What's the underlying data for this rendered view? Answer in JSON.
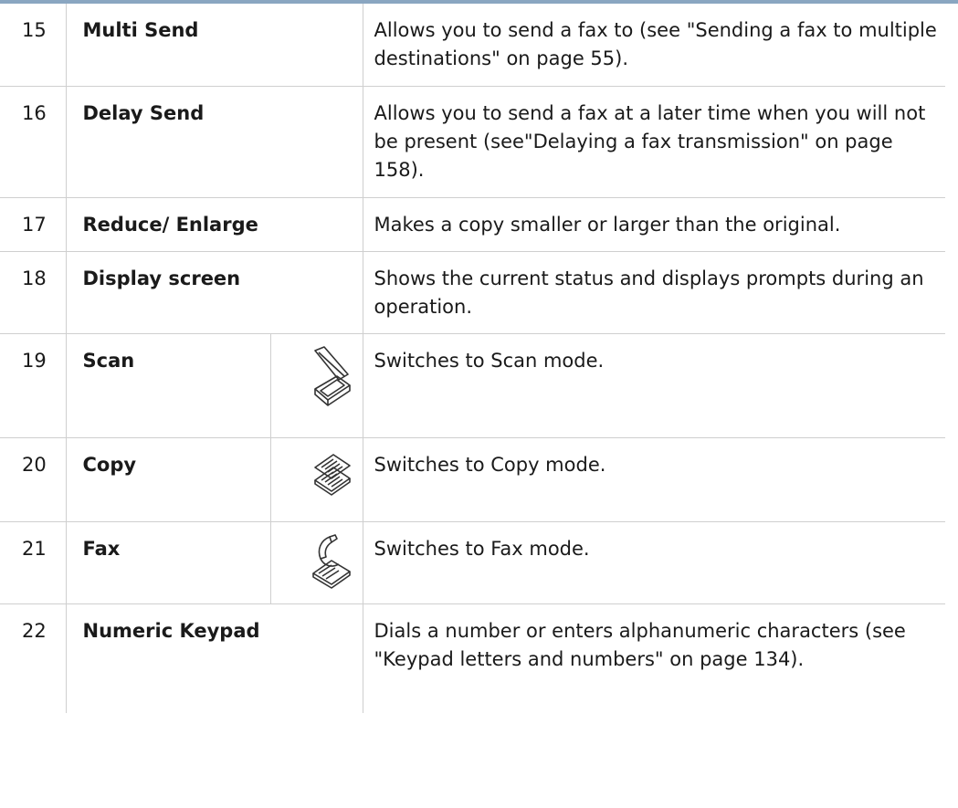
{
  "rows": [
    {
      "num": "15",
      "name": "Multi Send",
      "desc": "Allows you to send a fax to (see \"Sending a fax to multiple destinations\" on page 55)."
    },
    {
      "num": "16",
      "name": "Delay Send",
      "desc": "Allows you to send a fax at a later time when you will not be present (see\"Delaying a fax transmission\" on page 158)."
    },
    {
      "num": "17",
      "name": "Reduce/ Enlarge",
      "desc": "Makes a copy smaller or larger than the original."
    },
    {
      "num": "18",
      "name": "Display screen",
      "desc": "Shows the current status and displays prompts during an operation."
    },
    {
      "num": "19",
      "name": "Scan",
      "icon": "scanner-icon",
      "desc": "Switches to Scan mode."
    },
    {
      "num": "20",
      "name": "Copy",
      "icon": "copy-icon",
      "desc": "Switches to Copy mode."
    },
    {
      "num": "21",
      "name": "Fax",
      "icon": "fax-icon",
      "desc": "Switches to Fax mode."
    },
    {
      "num": "22",
      "name": "Numeric Keypad",
      "desc": "Dials a number or enters alphanumeric characters (see \"Keypad letters and numbers\" on page 134)."
    }
  ]
}
